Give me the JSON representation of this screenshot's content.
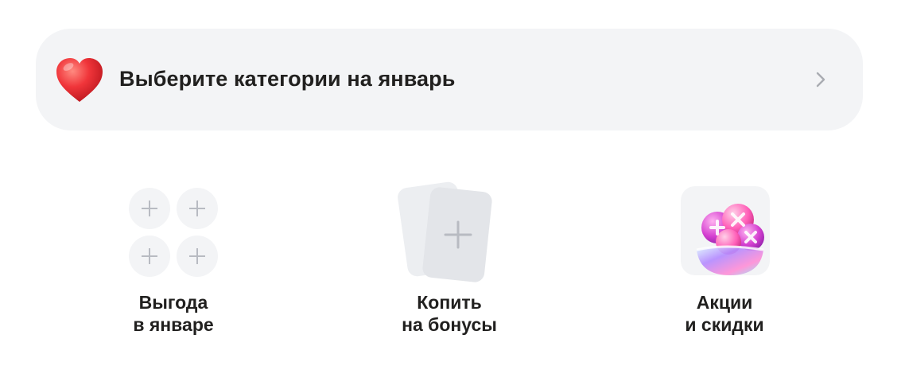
{
  "banner": {
    "title": "Выберите категории на январь",
    "icon": "heart-icon",
    "chevron_icon": "chevron-right-icon"
  },
  "tiles": [
    {
      "line1": "Выгода",
      "line2": "в январе",
      "icon": "plus-grid-icon"
    },
    {
      "line1": "Копить",
      "line2": "на бонусы",
      "icon": "add-card-icon"
    },
    {
      "line1": "Акции",
      "line2": "и скидки",
      "icon": "candy-bowl-icon"
    }
  ],
  "colors": {
    "banner_bg": "#f3f4f6",
    "text": "#21201f",
    "heart": "#f0353a",
    "placeholder": "#f3f4f6",
    "plus": "#b8bbc2"
  }
}
